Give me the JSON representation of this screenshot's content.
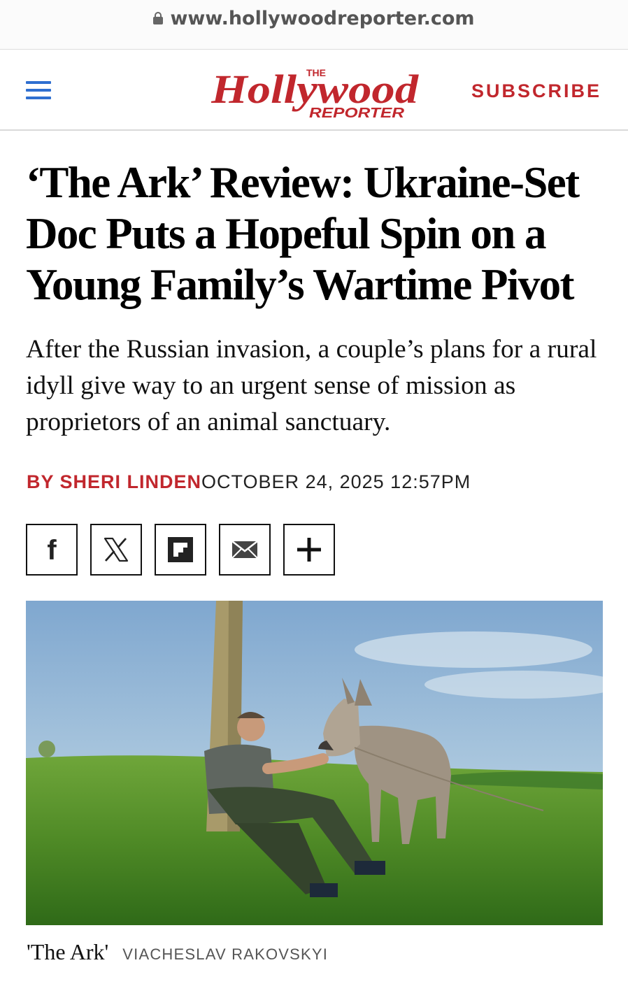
{
  "browser": {
    "url": "www.hollywoodreporter.com"
  },
  "header": {
    "logo_the": "THE",
    "logo_main": "Hollywood",
    "logo_sub": "REPORTER",
    "subscribe_label": "SUBSCRIBE",
    "brand_color": "#c1272d"
  },
  "article": {
    "headline": "‘The Ark’ Review: Ukraine-Set Doc Puts a Hopeful Spin on a Young Family’s Wartime Pivot",
    "dek": "After the Russian invasion, a couple’s plans for a rural idyll give way to an urgent sense of mission as proprietors of an animal sanctuary.",
    "byline": "BY SHERI LINDEN",
    "date": "OCTOBER 24, 2025 12:57PM"
  },
  "share": [
    {
      "icon": "facebook-icon"
    },
    {
      "icon": "x-icon"
    },
    {
      "icon": "flipboard-icon"
    },
    {
      "icon": "email-icon"
    },
    {
      "icon": "plus-icon"
    }
  ],
  "image": {
    "caption_title": "'The Ark'",
    "caption_credit": "VIACHESLAV RAKOVSKYI"
  }
}
